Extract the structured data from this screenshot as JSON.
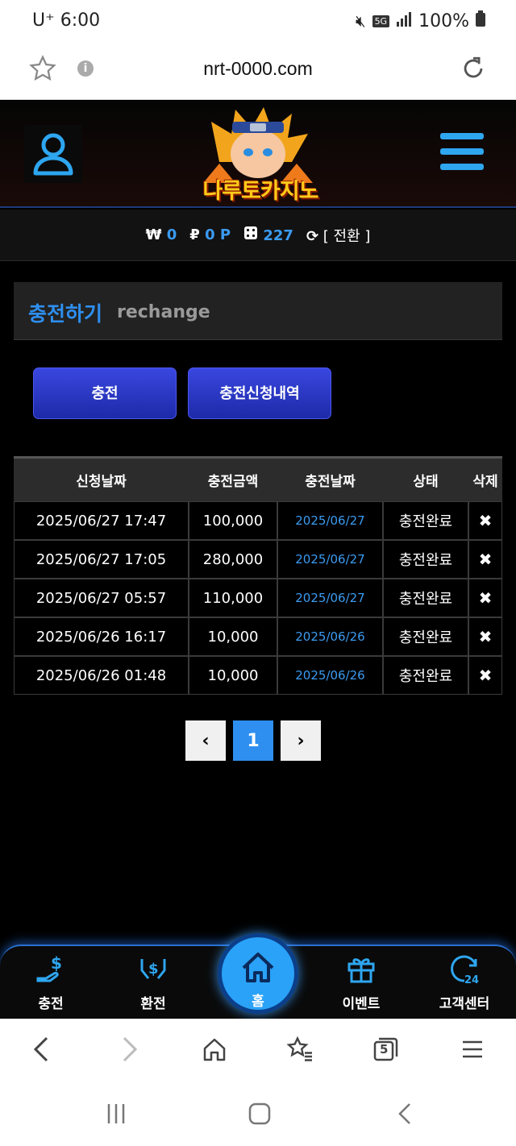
{
  "status_bar": {
    "carrier_time": "U⁺ 6:00",
    "network": "5G",
    "battery": "100%"
  },
  "browser": {
    "url": "nrt-0000.com",
    "tab_count": "5"
  },
  "site": {
    "logo_text": "나루토카지노"
  },
  "balance": {
    "won_symbol": "₩",
    "won_value": "0",
    "point_symbol": "₽",
    "point_value": "0 P",
    "coupon_value": "227",
    "switch_label": "[ 전환 ]"
  },
  "section": {
    "title_ko": "충전하기",
    "title_en": "rechange"
  },
  "tabs": [
    {
      "label": "충전"
    },
    {
      "label": "충전신청내역"
    }
  ],
  "table": {
    "headers": [
      "신청날짜",
      "충전금액",
      "충전날짜",
      "상태",
      "삭제"
    ],
    "rows": [
      {
        "request_date": "2025/06/27 17:47",
        "amount": "100,000",
        "charge_date": "2025/06/27",
        "status": "충전완료",
        "delete": "✖"
      },
      {
        "request_date": "2025/06/27 17:05",
        "amount": "280,000",
        "charge_date": "2025/06/27",
        "status": "충전완료",
        "delete": "✖"
      },
      {
        "request_date": "2025/06/27 05:57",
        "amount": "110,000",
        "charge_date": "2025/06/27",
        "status": "충전완료",
        "delete": "✖"
      },
      {
        "request_date": "2025/06/26 16:17",
        "amount": "10,000",
        "charge_date": "2025/06/26",
        "status": "충전완료",
        "delete": "✖"
      },
      {
        "request_date": "2025/06/26 01:48",
        "amount": "10,000",
        "charge_date": "2025/06/26",
        "status": "충전완료",
        "delete": "✖"
      }
    ]
  },
  "pagination": {
    "prev": "‹",
    "current": "1",
    "next": "›"
  },
  "bottom_nav": {
    "charge": "충전",
    "exchange": "환전",
    "home": "홈",
    "event": "이벤트",
    "support": "고객센터"
  },
  "colors": {
    "accent_blue": "#2e8ff0",
    "button_blue": "#2a36c8",
    "background": "#000000"
  }
}
